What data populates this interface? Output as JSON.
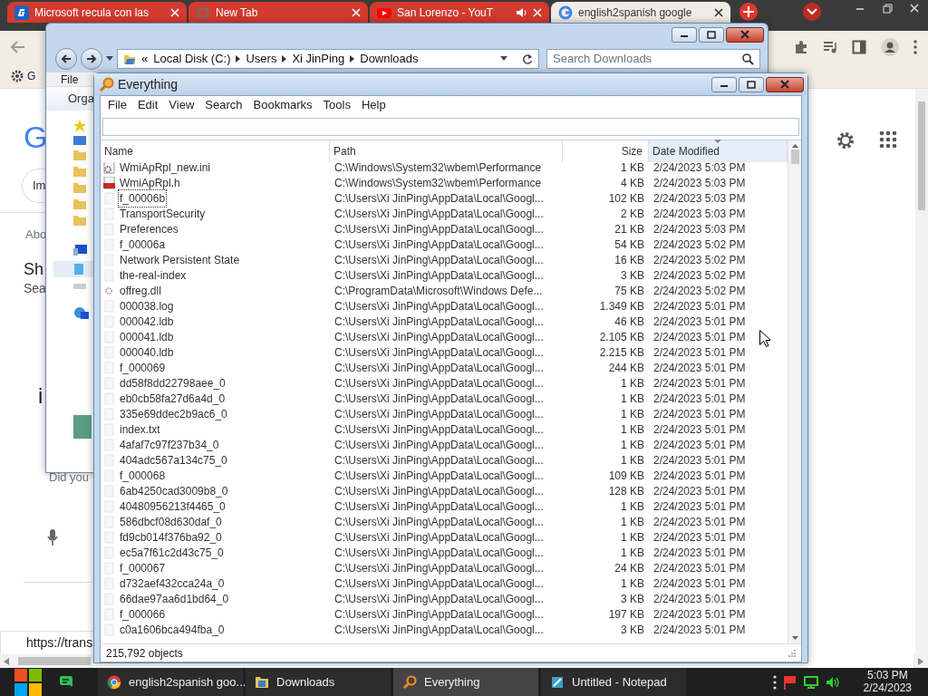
{
  "browser": {
    "tabs": [
      {
        "title": "Microsoft recula con las",
        "selected": false,
        "audio": false
      },
      {
        "title": "New Tab",
        "selected": false,
        "audio": false
      },
      {
        "title": "San Lorenzo - YouT",
        "selected": false,
        "audio": true
      },
      {
        "title": "english2spanish google",
        "selected": true,
        "audio": false
      }
    ],
    "bookmark": "G",
    "page": {
      "logo": "G",
      "chip": "Im",
      "about": "Abo",
      "heading": "Sh",
      "subheading": "Sea",
      "letter_1": "i",
      "did_you": "Did you",
      "status_url": "https://trans"
    }
  },
  "explorer": {
    "breadcrumb": [
      "«",
      "Local Disk (C:)",
      "Users",
      "Xi JinPing",
      "Downloads"
    ],
    "search_placeholder": "Search Downloads",
    "menu": [
      "File"
    ],
    "toolbar": "Orga"
  },
  "everything": {
    "title": "Everything",
    "menu": [
      "File",
      "Edit",
      "View",
      "Search",
      "Bookmarks",
      "Tools",
      "Help"
    ],
    "columns": [
      {
        "label": "Name",
        "sorted": false
      },
      {
        "label": "Path",
        "sorted": false
      },
      {
        "label": "Size",
        "sorted": false
      },
      {
        "label": "Date Modified",
        "sorted": true
      }
    ],
    "rows": [
      {
        "name": "WmiApRpl_new.ini",
        "path": "C:\\Windows\\System32\\wbem\\Performance",
        "size": "1 KB",
        "date": "2/24/2023 5:03 PM",
        "kind": "ini",
        "focused": false
      },
      {
        "name": "WmiApRpl.h",
        "path": "C:\\Windows\\System32\\wbem\\Performance",
        "size": "4 KB",
        "date": "2/24/2023 5:03 PM",
        "kind": "header",
        "focused": false
      },
      {
        "name": "f_00006b",
        "path": "C:\\Users\\Xi JinPing\\AppData\\Local\\Googl...",
        "size": "102 KB",
        "date": "2/24/2023 5:03 PM",
        "kind": "file",
        "focused": true
      },
      {
        "name": "TransportSecurity",
        "path": "C:\\Users\\Xi JinPing\\AppData\\Local\\Googl...",
        "size": "2 KB",
        "date": "2/24/2023 5:03 PM",
        "kind": "file",
        "focused": false
      },
      {
        "name": "Preferences",
        "path": "C:\\Users\\Xi JinPing\\AppData\\Local\\Googl...",
        "size": "21 KB",
        "date": "2/24/2023 5:03 PM",
        "kind": "file",
        "focused": false
      },
      {
        "name": "f_00006a",
        "path": "C:\\Users\\Xi JinPing\\AppData\\Local\\Googl...",
        "size": "54 KB",
        "date": "2/24/2023 5:02 PM",
        "kind": "file",
        "focused": false
      },
      {
        "name": "Network Persistent State",
        "path": "C:\\Users\\Xi JinPing\\AppData\\Local\\Googl...",
        "size": "16 KB",
        "date": "2/24/2023 5:02 PM",
        "kind": "file",
        "focused": false
      },
      {
        "name": "the-real-index",
        "path": "C:\\Users\\Xi JinPing\\AppData\\Local\\Googl...",
        "size": "3 KB",
        "date": "2/24/2023 5:02 PM",
        "kind": "file",
        "focused": false
      },
      {
        "name": "offreg.dll",
        "path": "C:\\ProgramData\\Microsoft\\Windows Defe...",
        "size": "75 KB",
        "date": "2/24/2023 5:02 PM",
        "kind": "dll",
        "focused": false
      },
      {
        "name": "000038.log",
        "path": "C:\\Users\\Xi JinPing\\AppData\\Local\\Googl...",
        "size": "1.349 KB",
        "date": "2/24/2023 5:01 PM",
        "kind": "file",
        "focused": false
      },
      {
        "name": "000042.ldb",
        "path": "C:\\Users\\Xi JinPing\\AppData\\Local\\Googl...",
        "size": "46 KB",
        "date": "2/24/2023 5:01 PM",
        "kind": "file",
        "focused": false
      },
      {
        "name": "000041.ldb",
        "path": "C:\\Users\\Xi JinPing\\AppData\\Local\\Googl...",
        "size": "2.105 KB",
        "date": "2/24/2023 5:01 PM",
        "kind": "file",
        "focused": false
      },
      {
        "name": "000040.ldb",
        "path": "C:\\Users\\Xi JinPing\\AppData\\Local\\Googl...",
        "size": "2.215 KB",
        "date": "2/24/2023 5:01 PM",
        "kind": "file",
        "focused": false
      },
      {
        "name": "f_000069",
        "path": "C:\\Users\\Xi JinPing\\AppData\\Local\\Googl...",
        "size": "244 KB",
        "date": "2/24/2023 5:01 PM",
        "kind": "file",
        "focused": false
      },
      {
        "name": "dd58f8dd22798aee_0",
        "path": "C:\\Users\\Xi JinPing\\AppData\\Local\\Googl...",
        "size": "1 KB",
        "date": "2/24/2023 5:01 PM",
        "kind": "file",
        "focused": false
      },
      {
        "name": "eb0cb58fa27d6a4d_0",
        "path": "C:\\Users\\Xi JinPing\\AppData\\Local\\Googl...",
        "size": "1 KB",
        "date": "2/24/2023 5:01 PM",
        "kind": "file",
        "focused": false
      },
      {
        "name": "335e69ddec2b9ac6_0",
        "path": "C:\\Users\\Xi JinPing\\AppData\\Local\\Googl...",
        "size": "1 KB",
        "date": "2/24/2023 5:01 PM",
        "kind": "file",
        "focused": false
      },
      {
        "name": "index.txt",
        "path": "C:\\Users\\Xi JinPing\\AppData\\Local\\Googl...",
        "size": "1 KB",
        "date": "2/24/2023 5:01 PM",
        "kind": "file",
        "focused": false
      },
      {
        "name": "4afaf7c97f237b34_0",
        "path": "C:\\Users\\Xi JinPing\\AppData\\Local\\Googl...",
        "size": "1 KB",
        "date": "2/24/2023 5:01 PM",
        "kind": "file",
        "focused": false
      },
      {
        "name": "404adc567a134c75_0",
        "path": "C:\\Users\\Xi JinPing\\AppData\\Local\\Googl...",
        "size": "1 KB",
        "date": "2/24/2023 5:01 PM",
        "kind": "file",
        "focused": false
      },
      {
        "name": "f_000068",
        "path": "C:\\Users\\Xi JinPing\\AppData\\Local\\Googl...",
        "size": "109 KB",
        "date": "2/24/2023 5:01 PM",
        "kind": "file",
        "focused": false
      },
      {
        "name": "6ab4250cad3009b8_0",
        "path": "C:\\Users\\Xi JinPing\\AppData\\Local\\Googl...",
        "size": "128 KB",
        "date": "2/24/2023 5:01 PM",
        "kind": "file",
        "focused": false
      },
      {
        "name": "40480956213f4465_0",
        "path": "C:\\Users\\Xi JinPing\\AppData\\Local\\Googl...",
        "size": "1 KB",
        "date": "2/24/2023 5:01 PM",
        "kind": "file",
        "focused": false
      },
      {
        "name": "586dbcf08d630daf_0",
        "path": "C:\\Users\\Xi JinPing\\AppData\\Local\\Googl...",
        "size": "1 KB",
        "date": "2/24/2023 5:01 PM",
        "kind": "file",
        "focused": false
      },
      {
        "name": "fd9cb014f376ba92_0",
        "path": "C:\\Users\\Xi JinPing\\AppData\\Local\\Googl...",
        "size": "1 KB",
        "date": "2/24/2023 5:01 PM",
        "kind": "file",
        "focused": false
      },
      {
        "name": "ec5a7f61c2d43c75_0",
        "path": "C:\\Users\\Xi JinPing\\AppData\\Local\\Googl...",
        "size": "1 KB",
        "date": "2/24/2023 5:01 PM",
        "kind": "file",
        "focused": false
      },
      {
        "name": "f_000067",
        "path": "C:\\Users\\Xi JinPing\\AppData\\Local\\Googl...",
        "size": "24 KB",
        "date": "2/24/2023 5:01 PM",
        "kind": "file",
        "focused": false
      },
      {
        "name": "d732aef432cca24a_0",
        "path": "C:\\Users\\Xi JinPing\\AppData\\Local\\Googl...",
        "size": "1 KB",
        "date": "2/24/2023 5:01 PM",
        "kind": "file",
        "focused": false
      },
      {
        "name": "66dae97aa6d1bd64_0",
        "path": "C:\\Users\\Xi JinPing\\AppData\\Local\\Googl...",
        "size": "3 KB",
        "date": "2/24/2023 5:01 PM",
        "kind": "file",
        "focused": false
      },
      {
        "name": "f_000066",
        "path": "C:\\Users\\Xi JinPing\\AppData\\Local\\Googl...",
        "size": "197 KB",
        "date": "2/24/2023 5:01 PM",
        "kind": "file",
        "focused": false
      },
      {
        "name": "c0a1606bca494fba_0",
        "path": "C:\\Users\\Xi JinPing\\AppData\\Local\\Googl...",
        "size": "3 KB",
        "date": "2/24/2023 5:01 PM",
        "kind": "file",
        "focused": false
      }
    ],
    "status": "215,792 objects"
  },
  "taskbar": {
    "items": [
      {
        "label": "english2spanish goo...",
        "selected": false
      },
      {
        "label": "Downloads",
        "selected": false
      },
      {
        "label": "Everything",
        "selected": true
      },
      {
        "label": "Untitled - Notepad",
        "selected": false
      }
    ],
    "time": "5:03 PM",
    "date": "2/24/2023"
  }
}
